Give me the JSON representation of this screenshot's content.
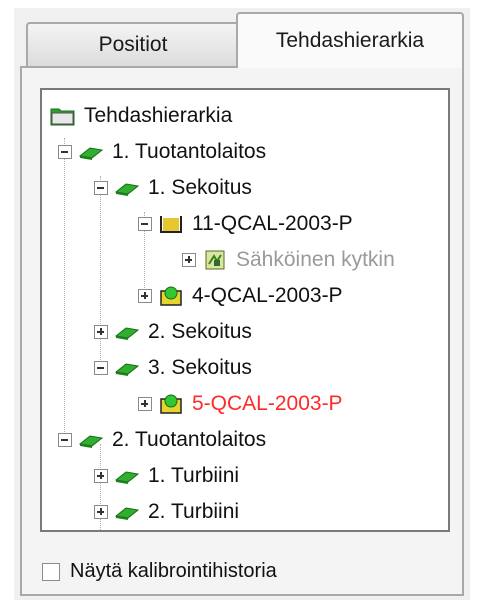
{
  "tabs": [
    {
      "label": "Positiot"
    },
    {
      "label": "Tehdashierarkia"
    }
  ],
  "tree": {
    "root": {
      "label": "Tehdashierarkia",
      "icon": "folder-icon"
    },
    "nodes": [
      {
        "label": "1. Tuotantolaitos",
        "icon": "plant-icon",
        "expanded": true,
        "level": 1
      },
      {
        "label": "1. Sekoitus",
        "icon": "plant-icon",
        "expanded": true,
        "level": 2
      },
      {
        "label": "11-QCAL-2003-P",
        "icon": "open-position-icon",
        "expanded": true,
        "level": 3
      },
      {
        "label": "Sähköinen kytkin",
        "icon": "device-icon",
        "expanded": false,
        "level": 4,
        "color": "#9a9a9a"
      },
      {
        "label": "4-QCAL-2003-P",
        "icon": "position-ok-icon",
        "expanded": false,
        "level": 3
      },
      {
        "label": "2. Sekoitus",
        "icon": "plant-icon",
        "expanded": false,
        "level": 2
      },
      {
        "label": "3. Sekoitus",
        "icon": "plant-icon",
        "expanded": true,
        "level": 2
      },
      {
        "label": "5-QCAL-2003-P",
        "icon": "position-ok-icon",
        "expanded": false,
        "level": 3,
        "color": "#ff2a2a"
      },
      {
        "label": "2. Tuotantolaitos",
        "icon": "plant-icon",
        "expanded": true,
        "level": 1
      },
      {
        "label": "1. Turbiini",
        "icon": "plant-icon",
        "expanded": false,
        "level": 2
      },
      {
        "label": "2. Turbiini",
        "icon": "plant-icon",
        "expanded": false,
        "level": 2
      }
    ]
  },
  "checkbox": {
    "label": "Näytä kalibrointihistoria",
    "checked": false
  }
}
